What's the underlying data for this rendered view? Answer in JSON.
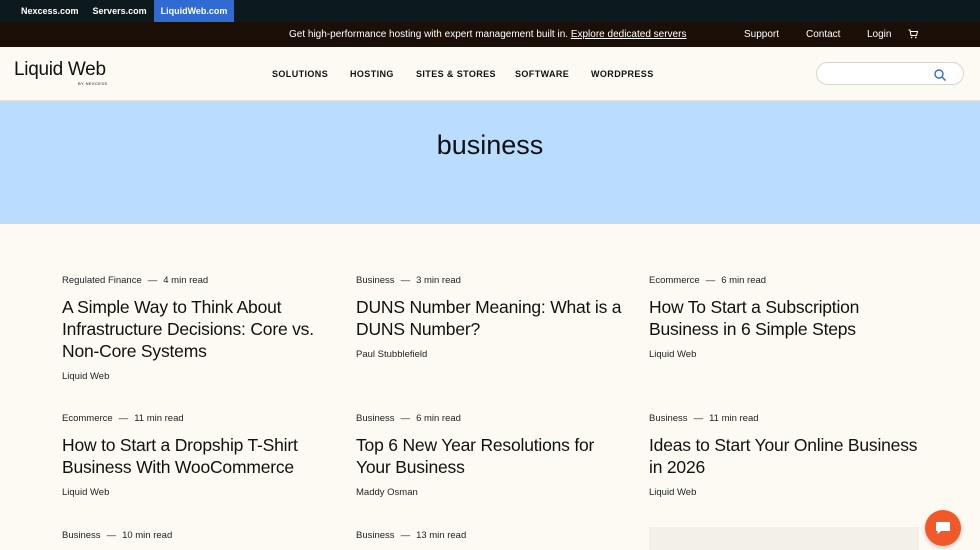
{
  "brandbar": {
    "items": [
      {
        "label": "Nexcess.com",
        "active": false
      },
      {
        "label": "Servers.com",
        "active": false
      },
      {
        "label": "LiquidWeb.com",
        "active": true
      }
    ]
  },
  "announce": {
    "message": "Get high-performance hosting with expert management built in.",
    "link_label": "Explore dedicated servers",
    "support": "Support",
    "contact": "Contact",
    "login": "Login",
    "cart_icon": "cart-icon"
  },
  "header": {
    "logo_text": "Liquid Web",
    "logo_sub": "BY NEXCESS",
    "nav": [
      "SOLUTIONS",
      "HOSTING",
      "SITES & STORES",
      "SOFTWARE",
      "WORDPRESS"
    ],
    "search_placeholder": "",
    "search_icon": "search-icon"
  },
  "hero": {
    "title": "business"
  },
  "posts": [
    {
      "category": "Regulated Finance",
      "read_time": "4 min read",
      "title": "A Simple Way to Think About Infrastructure Decisions: Core vs. Non-Core Systems",
      "author": "Liquid Web"
    },
    {
      "category": "Business",
      "read_time": "3 min read",
      "title": "DUNS Number Meaning: What is a DUNS Number?",
      "author": "Paul Stubblefield"
    },
    {
      "category": "Ecommerce",
      "read_time": "6 min read",
      "title": "How To Start a Subscription Business in 6 Simple Steps",
      "author": "Liquid Web"
    },
    {
      "category": "Ecommerce",
      "read_time": "11 min read",
      "title": "How to Start a Dropship T-Shirt Business With WooCommerce",
      "author": "Liquid Web"
    },
    {
      "category": "Business",
      "read_time": "6 min read",
      "title": "Top 6 New Year Resolutions for Your Business",
      "author": "Maddy Osman"
    },
    {
      "category": "Business",
      "read_time": "11 min read",
      "title": "Ideas to Start Your Online Business in 2026",
      "author": "Liquid Web"
    },
    {
      "category": "Business",
      "read_time": "10 min read",
      "title": "",
      "author": ""
    },
    {
      "category": "Business",
      "read_time": "13 min read",
      "title": "",
      "author": ""
    }
  ],
  "colors": {
    "brand_active": "#2f6bd3",
    "hero_bg": "#b9dcff",
    "chat_button": "#f05a28"
  },
  "chat_icon": "chat-bubble-icon"
}
